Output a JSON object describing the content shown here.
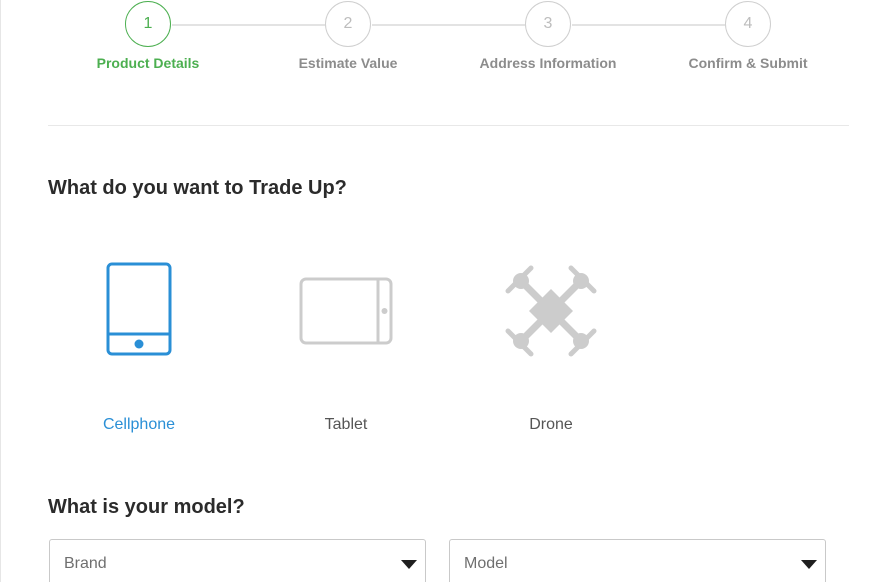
{
  "stepper": {
    "steps": [
      {
        "number": "1",
        "label": "Product Details",
        "active": true
      },
      {
        "number": "2",
        "label": "Estimate Value",
        "active": false
      },
      {
        "number": "3",
        "label": "Address Information",
        "active": false
      },
      {
        "number": "4",
        "label": "Confirm & Submit",
        "active": false
      }
    ]
  },
  "device_section": {
    "title": "What do you want to Trade Up?",
    "options": [
      {
        "label": "Cellphone",
        "icon": "cellphone-icon",
        "selected": true
      },
      {
        "label": "Tablet",
        "icon": "tablet-icon",
        "selected": false
      },
      {
        "label": "Drone",
        "icon": "drone-icon",
        "selected": false
      }
    ]
  },
  "model_section": {
    "title": "What is your model?",
    "brand_select": {
      "placeholder": "Brand"
    },
    "model_select": {
      "placeholder": "Model"
    }
  },
  "colors": {
    "active_step": "#4caf50",
    "selected_device": "#2a8fd6",
    "inactive_icon": "#cccccc"
  }
}
